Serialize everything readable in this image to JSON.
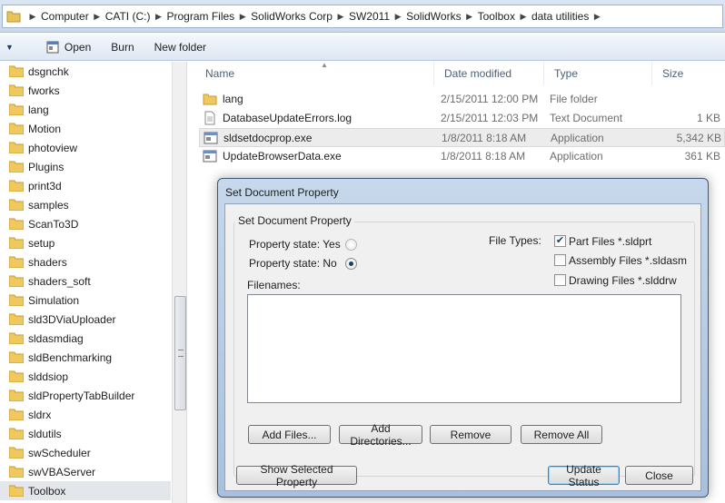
{
  "address": {
    "crumbs": [
      "Computer",
      "CATI (C:)",
      "Program Files",
      "SolidWorks Corp",
      "SW2011",
      "SolidWorks",
      "Toolbox",
      "data utilities"
    ]
  },
  "toolbar": {
    "organize_icon": "chevron-down-icon",
    "open_label": "Open",
    "burn_label": "Burn",
    "new_folder_label": "New folder"
  },
  "nav": {
    "items": [
      "dsgnchk",
      "fworks",
      "lang",
      "Motion",
      "photoview",
      "Plugins",
      "print3d",
      "samples",
      "ScanTo3D",
      "setup",
      "shaders",
      "shaders_soft",
      "Simulation",
      "sld3DViaUploader",
      "sldasmdiag",
      "sldBenchmarking",
      "slddsiop",
      "sldPropertyTabBuilder",
      "sldrx",
      "sldutils",
      "swScheduler",
      "swVBAServer",
      "Toolbox"
    ],
    "selected": "Toolbox"
  },
  "files": {
    "columns": {
      "name": "Name",
      "date": "Date modified",
      "type": "Type",
      "size": "Size"
    },
    "rows": [
      {
        "name": "lang",
        "date": "2/15/2011 12:00 PM",
        "type": "File folder",
        "size": "",
        "icon": "folder-icon"
      },
      {
        "name": "DatabaseUpdateErrors.log",
        "date": "2/15/2011 12:03 PM",
        "type": "Text Document",
        "size": "1 KB",
        "icon": "text-file-icon"
      },
      {
        "name": "sldsetdocprop.exe",
        "date": "1/8/2011 8:18 AM",
        "type": "Application",
        "size": "5,342 KB",
        "icon": "application-icon"
      },
      {
        "name": "UpdateBrowserData.exe",
        "date": "1/8/2011 8:18 AM",
        "type": "Application",
        "size": "361 KB",
        "icon": "application-icon"
      }
    ]
  },
  "dialog": {
    "title": "Set Document Property",
    "group_label": "Set Document Property",
    "state_yes_label": "Property state: Yes",
    "state_no_label": "Property state: No",
    "state_selected": "No",
    "file_types_label": "File Types:",
    "part_label": "Part Files *.sldprt",
    "part_checked": true,
    "assembly_label": "Assembly Files *.sldasm",
    "assembly_checked": false,
    "drawing_label": "Drawing Files *.slddrw",
    "drawing_checked": false,
    "filenames_label": "Filenames:",
    "add_files": "Add Files...",
    "add_dirs": "Add Directories...",
    "remove": "Remove",
    "remove_all": "Remove All",
    "show_selected": "Show Selected Property",
    "update_status": "Update Status",
    "close": "Close"
  }
}
